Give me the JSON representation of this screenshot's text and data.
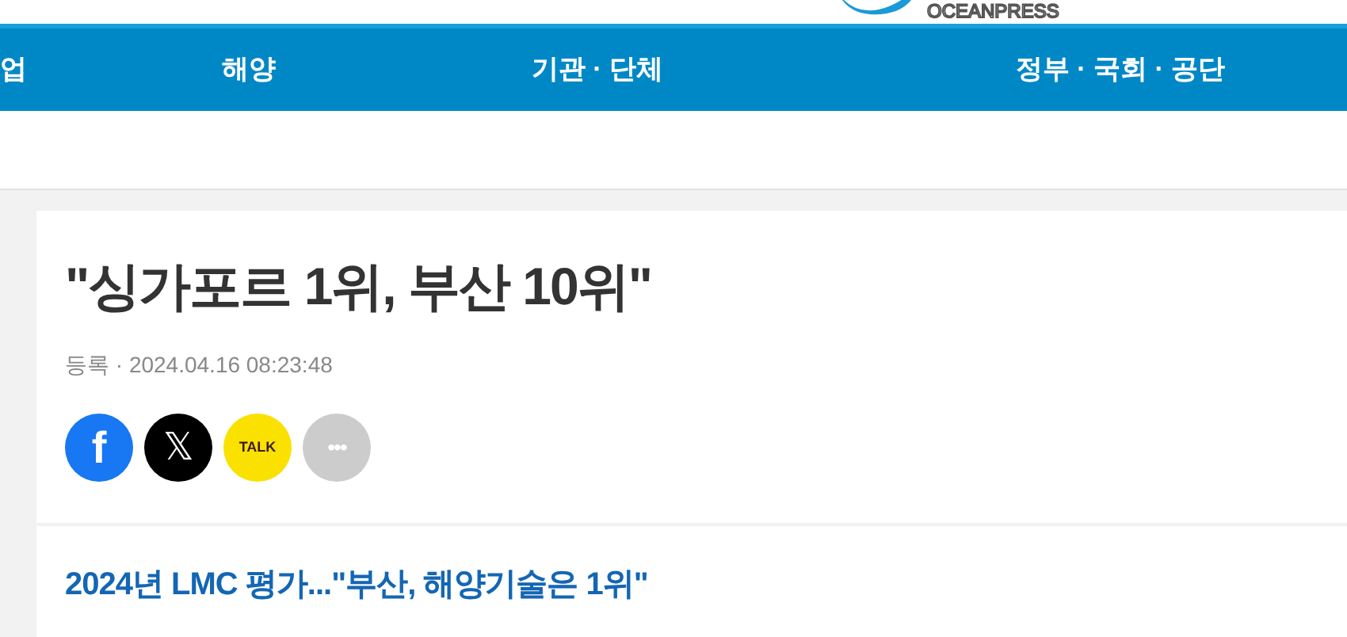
{
  "logo": {
    "text": "OCEANPRESS"
  },
  "nav": {
    "items": [
      {
        "label": "업"
      },
      {
        "label": "해양"
      },
      {
        "label": "기관 · 단체"
      },
      {
        "label": "정부 · 국회 · 공단"
      }
    ]
  },
  "article": {
    "title": "\"싱가포르 1위, 부산 10위\"",
    "meta": "등록 · 2024.04.16 08:23:48",
    "share": [
      {
        "kind": "facebook",
        "label": "f"
      },
      {
        "kind": "x",
        "label": "𝕏"
      },
      {
        "kind": "kakao",
        "label": "TALK"
      },
      {
        "kind": "more",
        "label": "•••"
      }
    ]
  },
  "subtitle": "2024년 LMC 평가...\"부산, 해양기술은 1위\""
}
